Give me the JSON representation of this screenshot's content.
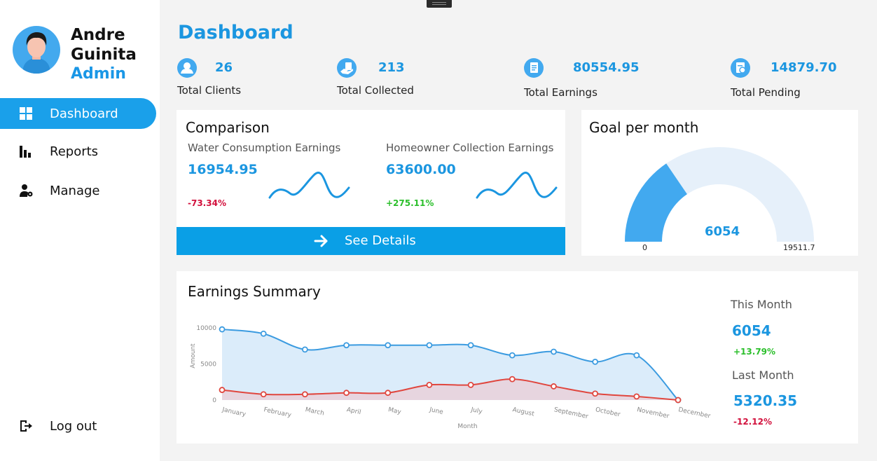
{
  "user": {
    "first_name": "Andre",
    "last_name": "Guinita",
    "role": "Admin"
  },
  "nav": {
    "items": [
      {
        "label": "Dashboard",
        "icon": "grid-icon",
        "active": true
      },
      {
        "label": "Reports",
        "icon": "bar-chart-icon",
        "active": false
      },
      {
        "label": "Manage",
        "icon": "user-gear-icon",
        "active": false
      }
    ],
    "logout": {
      "label": "Log out",
      "icon": "logout-icon"
    }
  },
  "page": {
    "title": "Dashboard"
  },
  "stats": [
    {
      "value": "26",
      "label": "Total Clients",
      "icon": "user-icon"
    },
    {
      "value": "213",
      "label": "Total Collected",
      "icon": "hand-payment-icon"
    },
    {
      "value": "80554.95",
      "label": "Total Earnings",
      "icon": "document-icon"
    },
    {
      "value": "14879.70",
      "label": "Total Pending",
      "icon": "pending-invoice-icon"
    }
  ],
  "comparison": {
    "title": "Comparison",
    "water": {
      "label": "Water Consumption Earnings",
      "value": "16954.95",
      "change": "-73.34%"
    },
    "homeowner": {
      "label": "Homeowner Collection Earnings",
      "value": "63600.00",
      "change": "+275.11%"
    },
    "button_label": "See Details"
  },
  "goal": {
    "title": "Goal per month",
    "value": "6054",
    "min": "0",
    "max": "19511.7",
    "fraction": 0.31
  },
  "summary": {
    "title": "Earnings Summary",
    "this_month": {
      "label": "This Month",
      "value": "6054",
      "change": "+13.79%"
    },
    "last_month": {
      "label": "Last Month",
      "value": "5320.35",
      "change": "-12.12%"
    }
  },
  "chart_data": {
    "type": "area",
    "categories": [
      "January",
      "February",
      "March",
      "April",
      "May",
      "June",
      "July",
      "August",
      "September",
      "October",
      "November",
      "December"
    ],
    "series": [
      {
        "values": [
          9800,
          9200,
          7000,
          7600,
          7600,
          7600,
          7600,
          6200,
          6700,
          5300,
          6200,
          0
        ],
        "color": "#3b9be0"
      },
      {
        "values": [
          1400,
          800,
          800,
          1000,
          1000,
          2100,
          2100,
          2900,
          1900,
          900,
          500,
          0
        ],
        "color": "#e0463e"
      }
    ],
    "xlabel": "Month",
    "ylabel": "Amount",
    "yticks": [
      "10000",
      "5000",
      "0"
    ],
    "ylim": [
      0,
      10000
    ],
    "grid": false
  }
}
